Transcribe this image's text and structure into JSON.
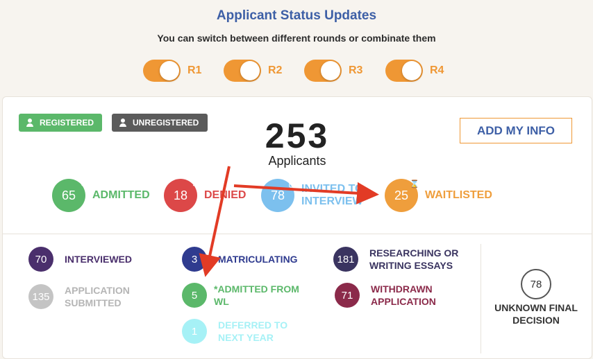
{
  "header": {
    "title": "Applicant Status Updates",
    "subtitle": "You can switch between different rounds or combinate them"
  },
  "rounds": [
    {
      "label": "R1",
      "on": true
    },
    {
      "label": "R2",
      "on": true
    },
    {
      "label": "R3",
      "on": true
    },
    {
      "label": "R4",
      "on": true
    }
  ],
  "badges": {
    "registered": "REGISTERED",
    "unregistered": "UNREGISTERED"
  },
  "total": {
    "count": "253",
    "label": "Applicants"
  },
  "add_button": "ADD MY INFO",
  "primary": {
    "admitted": {
      "count": "65",
      "label": "ADMITTED",
      "color": "#5bb86a"
    },
    "denied": {
      "count": "18",
      "label": "DENIED",
      "color": "#dc4848"
    },
    "invited": {
      "count": "78",
      "label_line1": "INVITED TO",
      "label_line2": "INTERVIEW",
      "color": "#7cc0ee"
    },
    "waitlisted": {
      "count": "25",
      "label": "WAITLISTED",
      "color": "#ef9e3c"
    }
  },
  "secondary": {
    "interviewed": {
      "count": "70",
      "line1": "INTERVIEWED",
      "line2": "",
      "color": "#4a2f6c"
    },
    "submitted": {
      "count": "135",
      "line1": "APPLICATION",
      "line2": "SUBMITTED",
      "color": "#c4c4c4"
    },
    "matriculating": {
      "count": "3",
      "line1": "MATRICULATING",
      "line2": "",
      "color": "#2f3b8f"
    },
    "admitted_wl": {
      "count": "5",
      "line1": "*ADMITTED FROM",
      "line2": "WL",
      "color": "#5bb86a"
    },
    "deferred": {
      "count": "1",
      "line1": "DEFERRED TO",
      "line2": "NEXT YEAR",
      "color": "#a6f1f6"
    },
    "researching": {
      "count": "181",
      "line1": "RESEARCHING OR",
      "line2": "WRITING ESSAYS",
      "color": "#3a3460"
    },
    "withdrawn": {
      "count": "71",
      "line1": "WITHDRAWN",
      "line2": "APPLICATION",
      "color": "#8b2a4a"
    }
  },
  "unknown": {
    "count": "78",
    "line1": "UNKNOWN FINAL",
    "line2": "DECISION"
  },
  "colors": {
    "accent_orange": "#ef9734",
    "title_blue": "#3d5fa6",
    "arrow_red": "#e23b25"
  }
}
